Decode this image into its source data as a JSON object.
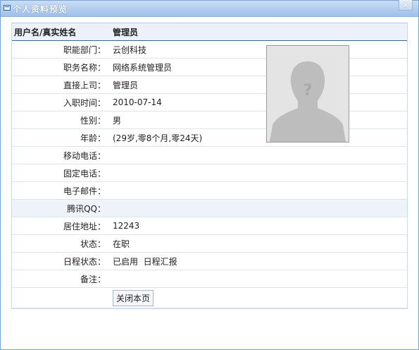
{
  "window": {
    "title": "个人资料预览",
    "close_symbol": "×"
  },
  "header": {
    "label": "用户名/真实姓名",
    "value": "管理员"
  },
  "rows": [
    {
      "label": "职能部门：",
      "value": "云创科技"
    },
    {
      "label": "职务名称：",
      "value": "网络系统管理员"
    },
    {
      "label": "直接上司：",
      "value": "管理员"
    },
    {
      "label": "入职时间：",
      "value": "2010-07-14"
    },
    {
      "label": "性别：",
      "value": "男"
    },
    {
      "label": "年龄：",
      "value": "(29岁,零8个月,零24天)"
    },
    {
      "label": "移动电话：",
      "value": ""
    },
    {
      "label": "固定电话：",
      "value": ""
    },
    {
      "label": "电子邮件：",
      "value": ""
    },
    {
      "label": "腾讯QQ：",
      "value": ""
    },
    {
      "label": "居住地址：",
      "value": "12243"
    },
    {
      "label": "状态：",
      "value": "在职"
    },
    {
      "label": "日程状态：",
      "value": "已启用  日程汇报"
    },
    {
      "label": "备注：",
      "value": ""
    }
  ],
  "close_page_button": "关闭本页",
  "photo": {
    "icon": "default-avatar-silhouette",
    "question_mark": "?"
  }
}
